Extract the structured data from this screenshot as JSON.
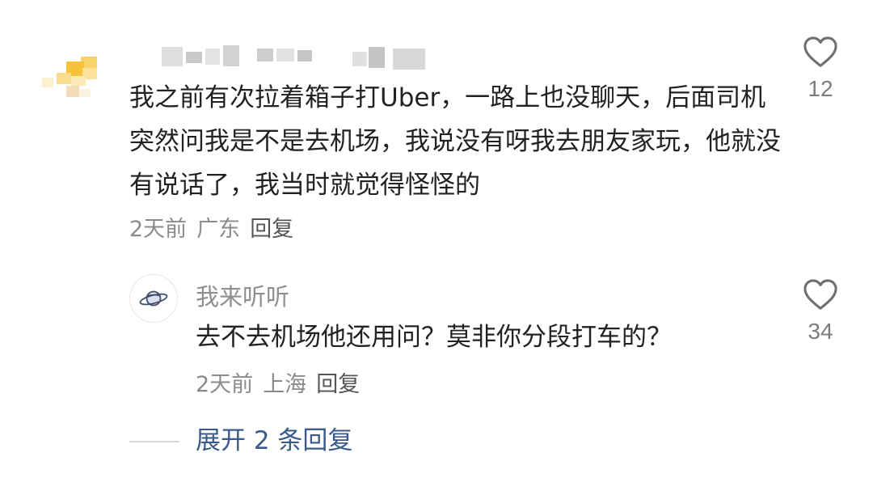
{
  "main_comment": {
    "text": "我之前有次拉着箱子打Uber，一路上也没聊天，后面司机突然问我是不是去机场，我说没有呀我去朋友家玩，他就没有说话了，我当时就觉得怪怪的",
    "time": "2天前",
    "location": "广东",
    "reply_label": "回复",
    "like_count": "12"
  },
  "reply": {
    "username": "我来听听",
    "text": "去不去机场他还用问？莫非你分段打车的？",
    "time": "2天前",
    "location": "上海",
    "reply_label": "回复",
    "like_count": "34"
  },
  "expand": {
    "label": "展开 2 条回复"
  },
  "colors": {
    "avatar_accent": "#f6c23a",
    "link": "#3a5a8c",
    "meta": "#8b8b8b"
  },
  "icons": {
    "like": "heart-icon",
    "reply_avatar": "planet-icon"
  }
}
